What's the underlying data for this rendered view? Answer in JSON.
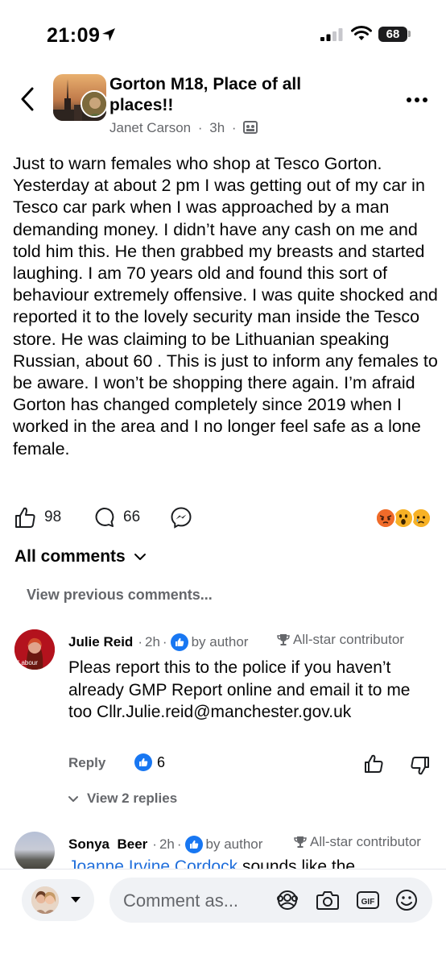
{
  "status_bar": {
    "time": "21:09",
    "battery": "68"
  },
  "header": {
    "group_name": "Gorton M18, Place of all places!!",
    "author": "Janet Carson",
    "separator": "·",
    "age": "3h",
    "back_icon": "chevron-left-icon",
    "more_icon": "more-horizontal-icon",
    "privacy_icon": "group-members-icon"
  },
  "post": {
    "text": "Just to warn females who shop at Tesco Gorton. Yesterday at about 2 pm I was getting out of my car in Tesco car park when I was approached by a man demanding money. I didn’t have any cash on me and told him this. He then grabbed my breasts and started laughing. I am 70 years old and found this sort of behaviour extremely offensive. I was quite shocked and reported it to the lovely security man inside the Tesco store. He was claiming to be Lithuanian speaking Russian, about 60 . This is just to inform any females to be aware. I won’t be shopping there again. I’m afraid Gorton has changed completely since 2019 when I worked in the area and I no longer feel safe as a lone female."
  },
  "reactions": {
    "likes": "98",
    "comments": "66",
    "emojis": [
      "angry",
      "wow",
      "sad"
    ]
  },
  "comments_section": {
    "filter_label": "All comments",
    "view_previous": "View previous comments..."
  },
  "comments": [
    {
      "name": "Julie Reid",
      "time": "2h",
      "separator": "·",
      "author_badge": "by author",
      "contributor_badge": "All-star contributor",
      "avatar_text": "Labour",
      "text": "Pleas report this to the police if you haven’t already GMP Report online and email it to me too Cllr.Julie.reid@manchester.gov.uk",
      "reply_label": "Reply",
      "like_count": "6",
      "view_replies": "View 2 replies"
    },
    {
      "name": "Sonya  Beer",
      "time": "2h",
      "separator": "·",
      "author_badge": "by author",
      "contributor_badge": "All-star contributor",
      "mention": "Joanne Irvine Cordock",
      "text_rest": " sounds like the"
    }
  ],
  "composer": {
    "placeholder": "Comment as...",
    "icons": [
      "avatar-sticker-icon",
      "camera-icon",
      "gif-icon",
      "emoji-icon"
    ]
  },
  "colors": {
    "brand_blue": "#1877f2",
    "secondary_text": "#65676b",
    "mention_blue": "#216fdb",
    "labour_red": "#b3121d"
  }
}
